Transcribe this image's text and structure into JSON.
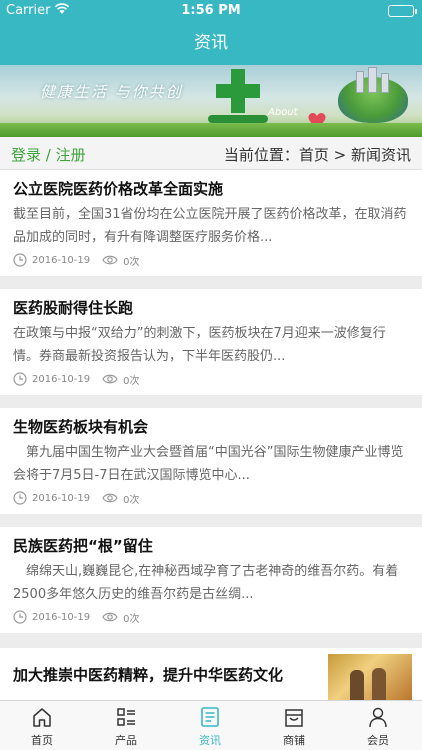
{
  "status_bar": {
    "carrier": "Carrier",
    "time": "1:56 PM"
  },
  "nav": {
    "title": "资讯"
  },
  "banner": {
    "slogan": "健康生活  与你共创",
    "about_text": "About"
  },
  "breadcrumb": {
    "login_text": "登录 / 注册",
    "location_text": "当前位置：首页 > 新闻资讯"
  },
  "news": [
    {
      "title": "公立医院医药价格改革全面实施",
      "summary": "截至目前，全国31省份均在公立医院开展了医药价格改革，在取消药品加成的同时，有升有降调整医疗服务价格...",
      "date": "2016-10-19",
      "views": "0次"
    },
    {
      "title": "医药股耐得住长跑",
      "summary": "在政策与中报“双给力”的刺激下，医药板块在7月迎来一波修复行情。券商最新投资报告认为，下半年医药股仍...",
      "date": "2016-10-19",
      "views": "0次"
    },
    {
      "title": "生物医药板块有机会",
      "summary": "　第九届中国生物产业大会暨首届“中国光谷”国际生物健康产业博览会将于7月5日-7日在武汉国际博览中心...",
      "date": "2016-10-19",
      "views": "0次"
    },
    {
      "title": "民族医药把“根”留住",
      "summary": "　绵绵天山,巍巍昆仑,在神秘西域孕育了古老神奇的维吾尔药。有着2500多年悠久历史的维吾尔药是古丝绸...",
      "date": "2016-10-19",
      "views": "0次"
    },
    {
      "title": "加大推崇中医药精粹，提升中华医药文化"
    }
  ],
  "tabs": [
    {
      "label": "首页",
      "icon": "home-icon"
    },
    {
      "label": "产品",
      "icon": "product-grid-icon"
    },
    {
      "label": "资讯",
      "icon": "news-icon",
      "active": true
    },
    {
      "label": "商铺",
      "icon": "shop-icon"
    },
    {
      "label": "会员",
      "icon": "member-icon"
    }
  ],
  "colors": {
    "accent": "#38b8c3",
    "login_green": "#3ca53c"
  }
}
